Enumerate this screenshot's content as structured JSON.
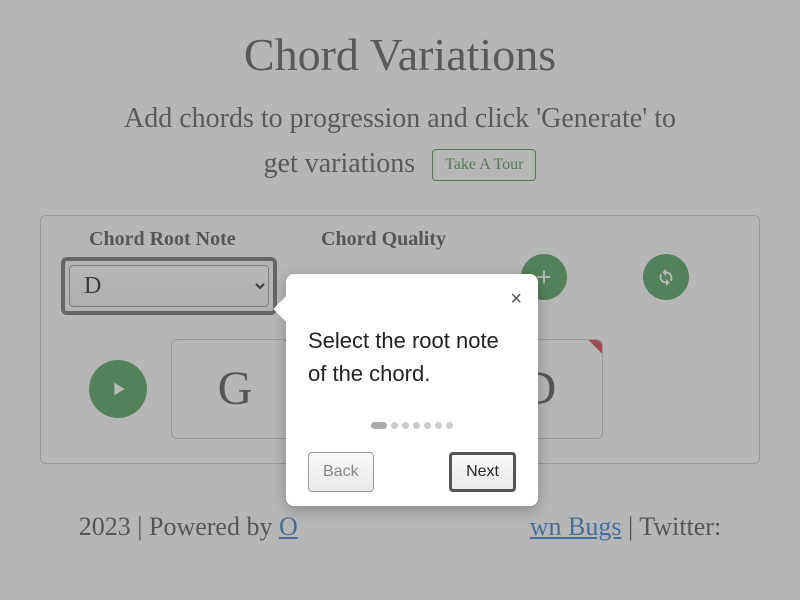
{
  "title": "Chord Variations",
  "subtitle_a": "Add chords to progression and click 'Generate' to",
  "subtitle_b": "get variations",
  "tour_button": "Take A Tour",
  "labels": {
    "root": "Chord Root Note",
    "quality": "Chord Quality"
  },
  "root_select": {
    "value": "D"
  },
  "quality_select": {
    "value": ""
  },
  "cards": {
    "c0": "G",
    "c1": "D"
  },
  "footer": {
    "year": "2023",
    "powered": " | Powered by ",
    "link1_a": "O",
    "link2": "wn Bugs",
    "twitter": " | Twitter:"
  },
  "popover": {
    "text": "Select the root note of the chord.",
    "back": "Back",
    "next": "Next"
  }
}
